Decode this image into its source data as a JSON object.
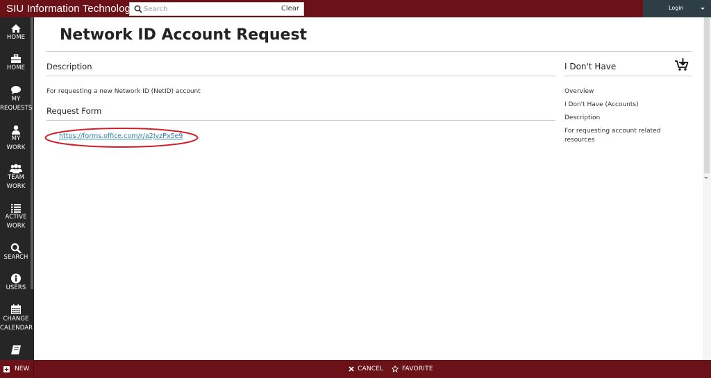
{
  "header": {
    "app_title": "SIU Information Technology",
    "search_placeholder": "Search",
    "clear_label": "Clear",
    "login_label": "Login"
  },
  "sidebar": {
    "items": [
      {
        "label": "HOME",
        "icon": "home-icon"
      },
      {
        "label": "HOME",
        "icon": "briefcase-icon"
      },
      {
        "label": "MY\nREQUESTS",
        "icon": "speech-bubble-icon"
      },
      {
        "label": "MY\nWORK",
        "icon": "user-icon"
      },
      {
        "label": "TEAM\nWORK",
        "icon": "team-icon"
      },
      {
        "label": "ACTIVE\nWORK",
        "icon": "list-icon"
      },
      {
        "label": "SEARCH",
        "icon": "search-icon"
      },
      {
        "label": "USERS",
        "icon": "info-icon"
      },
      {
        "label": "CHANGE\nCALENDAR",
        "icon": "calendar-icon"
      },
      {
        "label": "",
        "icon": "book-icon"
      }
    ]
  },
  "main": {
    "title": "Network ID Account Request",
    "description_heading": "Description",
    "description_text": "For requesting a new Network ID (NetID) account",
    "request_form_heading": "Request Form",
    "request_link": "https://forms.office.com/r/a2JvzPx5e9"
  },
  "right_panel": {
    "heading": "I Don't Have",
    "items": [
      "Overview",
      "I Don't Have (Accounts)",
      "Description",
      "For requesting account related resources"
    ]
  },
  "footer": {
    "new_label": "NEW",
    "cancel_label": "CANCEL",
    "favorite_label": "FAVORITE"
  },
  "colors": {
    "brand_maroon": "#6b1218",
    "sidebar_bg": "#262626",
    "login_bg": "#2e3e45",
    "link": "#2a82a7",
    "highlight_circle": "#d0202a"
  }
}
